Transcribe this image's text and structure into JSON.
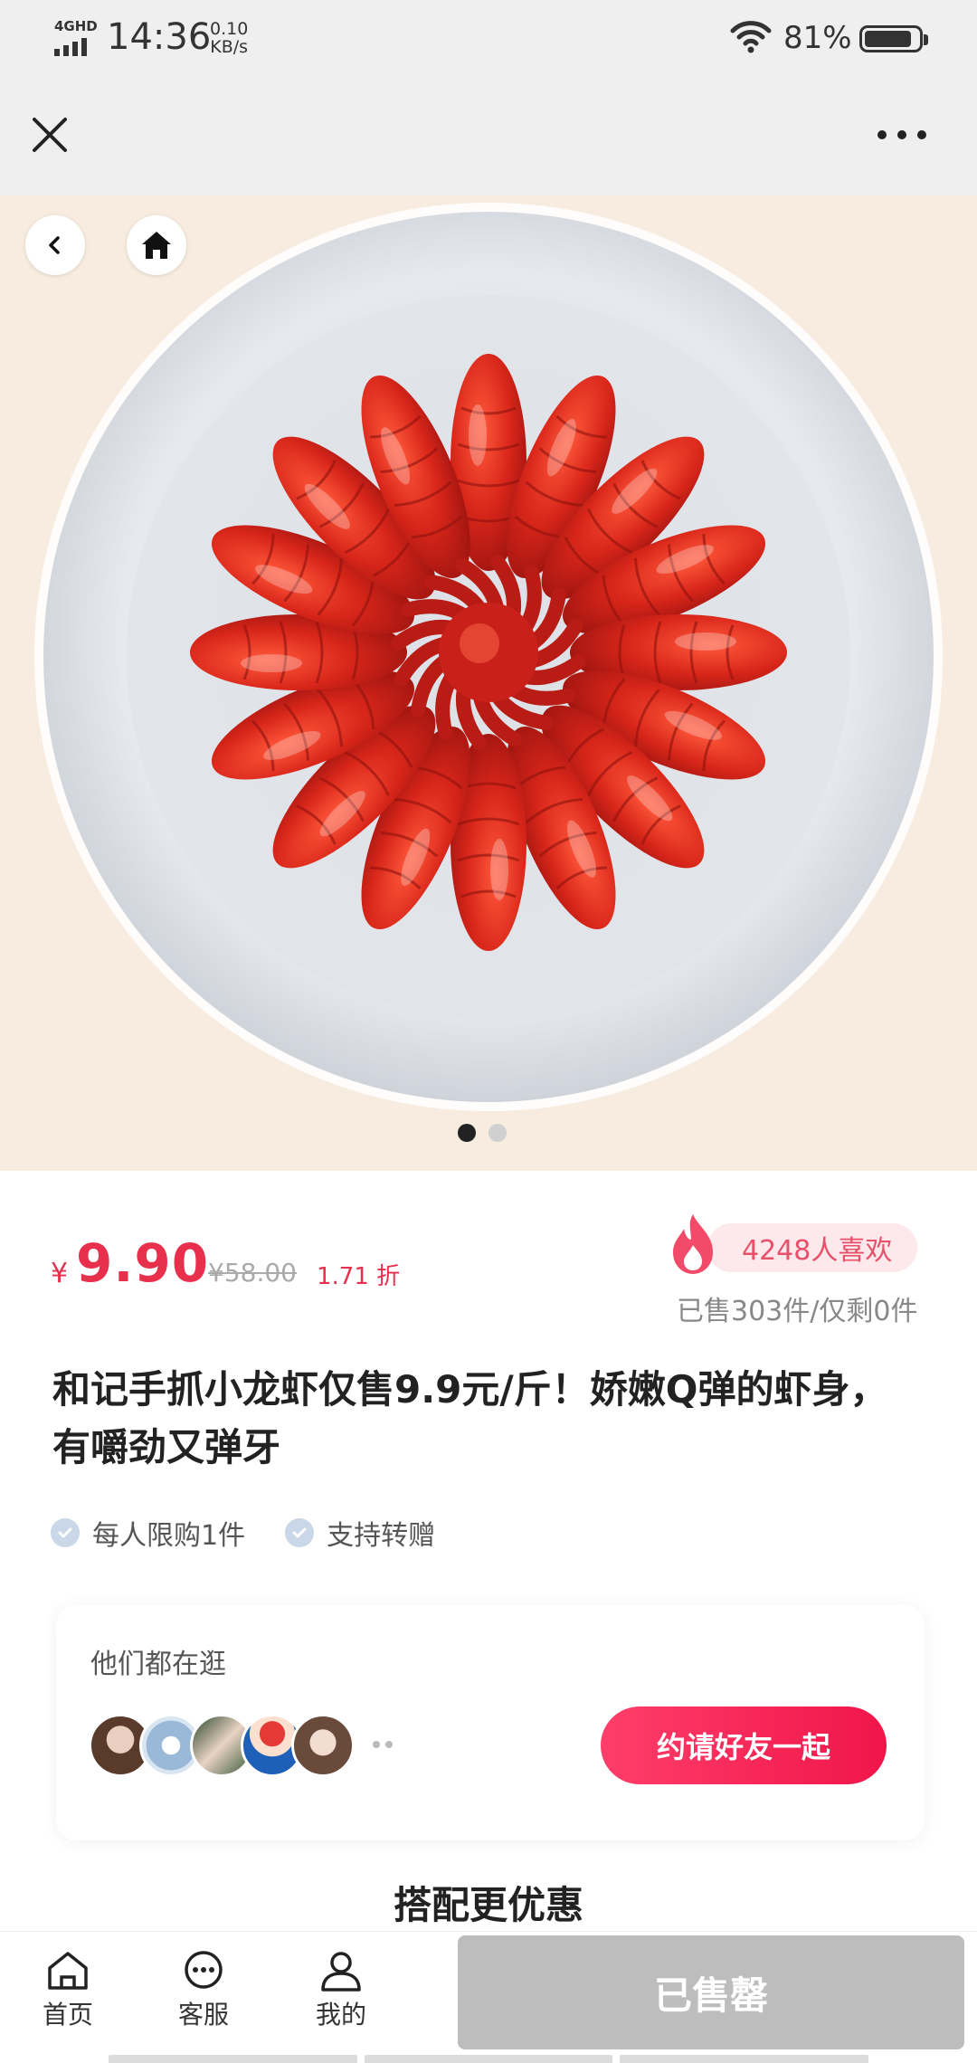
{
  "status_bar": {
    "network": "4GHD",
    "time": "14:36",
    "speed_value": "0.10",
    "speed_unit": "KB/s",
    "battery": "81%"
  },
  "nav": {
    "close_icon": "close-icon",
    "more_icon": "more-icon"
  },
  "gallery": {
    "image_count": 2,
    "active_index": 0,
    "back_icon": "back-icon",
    "home_icon": "home-icon"
  },
  "product": {
    "currency": "¥",
    "price": "9.90",
    "original_price": "¥58.00",
    "discount": "1.71 折",
    "likes": "4248人喜欢",
    "sold_info": "已售303件/仅剩0件",
    "title": "和记手抓小龙虾仅售9.9元/斤！娇嫩Q弹的虾身，有嚼劲又弹牙",
    "tags": [
      {
        "label": "每人限购1件"
      },
      {
        "label": "支持转赠"
      }
    ]
  },
  "browsing": {
    "title": "他们都在逛",
    "invite_label": "约请好友一起"
  },
  "section_heading": "搭配更优惠",
  "bottom_bar": {
    "tabs": [
      {
        "label": "首页",
        "icon": "home-icon"
      },
      {
        "label": "客服",
        "icon": "chat-icon"
      },
      {
        "label": "我的",
        "icon": "user-icon"
      }
    ],
    "action_label": "已售罄"
  },
  "colors": {
    "accent": "#e8304c",
    "soldout": "#bdbdbd",
    "hero_bg": "#f7ecdf"
  }
}
